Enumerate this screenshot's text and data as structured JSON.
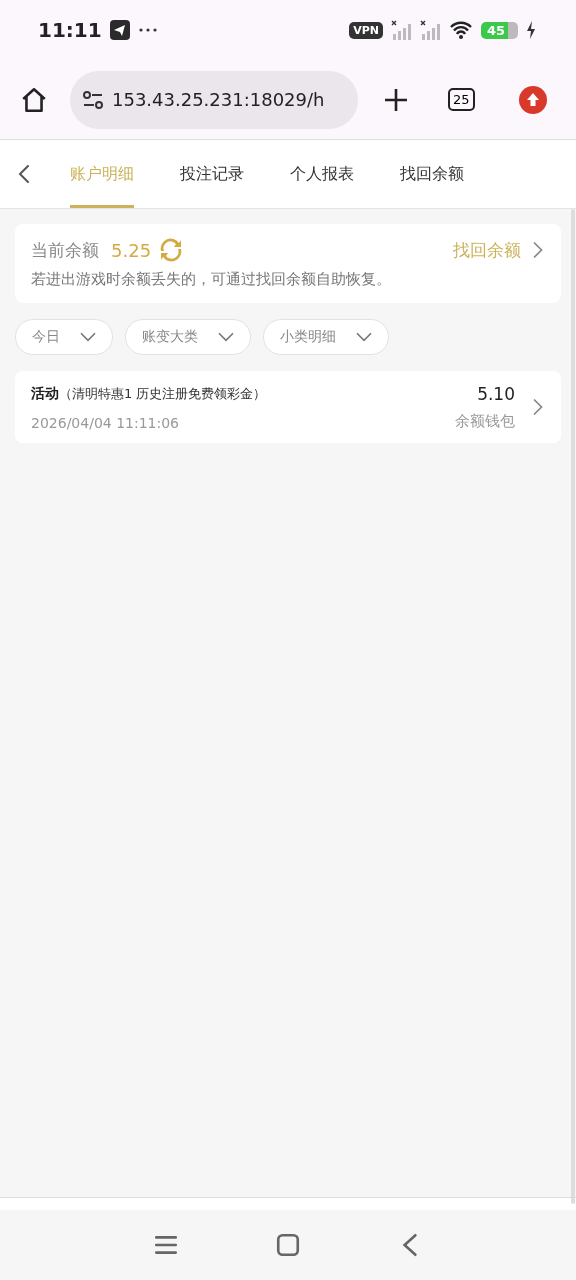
{
  "status_bar": {
    "time": "11:11",
    "vpn": "VPN",
    "battery": "45"
  },
  "browser": {
    "url": "153.43.25.231:18029/h",
    "tab_count": "25"
  },
  "tabs": [
    {
      "label": "账户明细",
      "selected": true
    },
    {
      "label": "投注记录",
      "selected": false
    },
    {
      "label": "个人报表",
      "selected": false
    },
    {
      "label": "找回余额",
      "selected": false
    }
  ],
  "balance_card": {
    "label": "当前余额",
    "amount": "5.25",
    "link": "找回余额",
    "note": "若进出游戏时余额丢失的，可通过找回余额自助恢复。"
  },
  "filters": [
    {
      "label": "今日"
    },
    {
      "label": "账变大类"
    },
    {
      "label": "小类明细"
    }
  ],
  "records": [
    {
      "title": "活动",
      "detail": "（清明特惠1 历史注册免费领彩金）",
      "time": "2026/04/04 11:11:06",
      "amount": "5.10",
      "wallet": "余额钱包"
    }
  ]
}
